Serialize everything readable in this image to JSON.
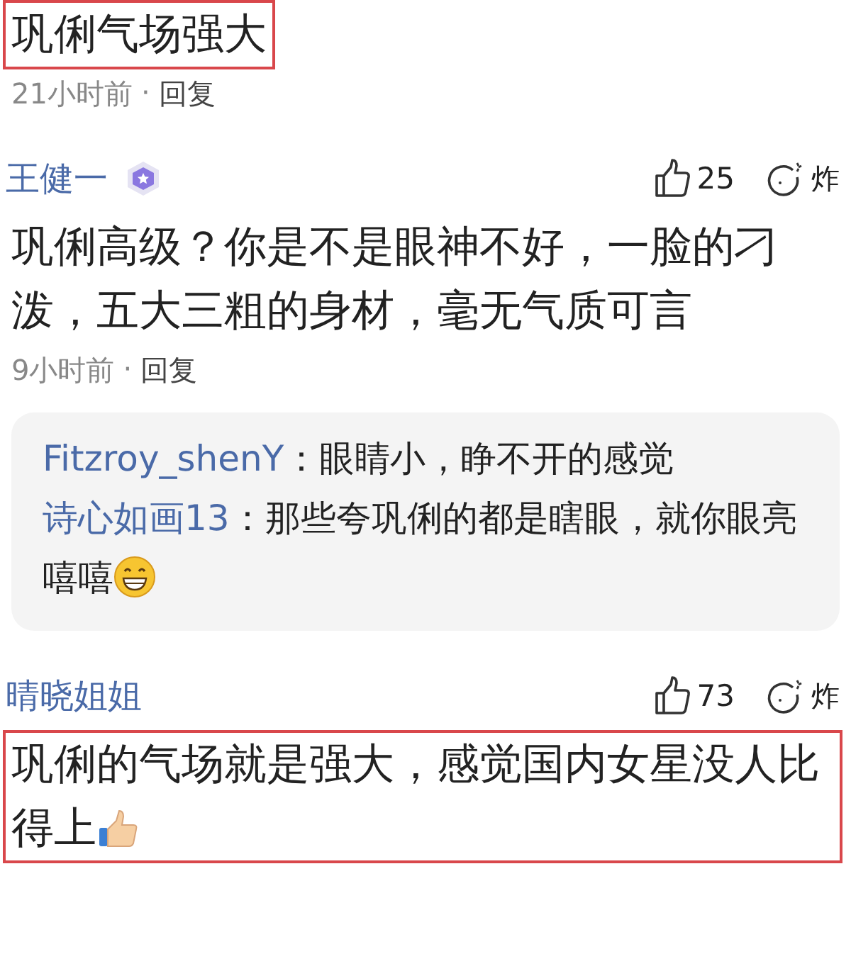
{
  "comments": [
    {
      "kind": "plain",
      "text": "巩俐气场强大",
      "highlighted": true,
      "time": "21小时前",
      "sep": "·",
      "reply": "回复"
    },
    {
      "kind": "plain",
      "author": "王健一",
      "badge": true,
      "likes": "25",
      "bomb": "炸",
      "text": "巩俐高级？你是不是眼神不好，一脸的刁泼，五大三粗的身材，毫无气质可言",
      "highlighted": false,
      "time": "9小时前",
      "sep": "·",
      "reply": "回复",
      "replies": [
        {
          "kind": "plain",
          "author": "Fitzroy_shenY",
          "text": "：眼睛小，睁不开的感觉"
        },
        {
          "kind": "grin",
          "author": "诗心如画13",
          "text": "：那些夸巩俐的都是瞎眼，就你眼亮嘻嘻"
        }
      ]
    },
    {
      "kind": "thumbs",
      "author": "晴晓姐姐",
      "badge": false,
      "likes": "73",
      "bomb": "炸",
      "text": "巩俐的气场就是强大，感觉国内女星没人比得上",
      "highlighted": true
    }
  ]
}
